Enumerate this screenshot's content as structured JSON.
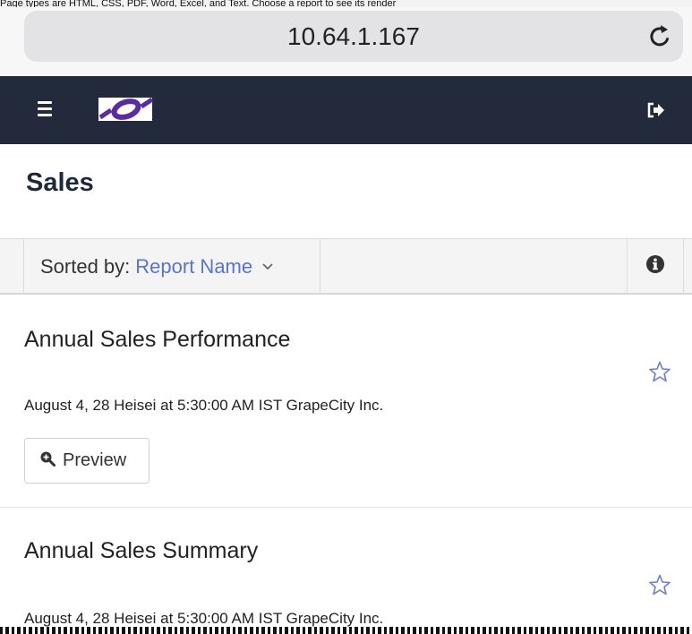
{
  "top_fragment": "Page types are HTML, CSS, PDF, Word, Excel, and Text. Choose a report to see its render",
  "browser": {
    "url": "10.64.1.167",
    "reload_icon": "reload-icon"
  },
  "navbar": {
    "menu_icon": "hamburger-menu-icon",
    "logo": "brand-logo",
    "logout_icon": "logout-icon",
    "background": "#232a3b"
  },
  "page": {
    "title": "Sales"
  },
  "toolbar": {
    "sort_label": "Sorted by:",
    "sort_value": "Report Name",
    "sort_accent": "#5b73c9",
    "info_icon": "info-icon"
  },
  "reports": [
    {
      "name": "Annual Sales Performance",
      "meta": "August 4, 28 Heisei at 5:30:00 AM IST GrapeCity Inc.",
      "favorite_icon": "star-outline-icon",
      "preview_label": "Preview"
    },
    {
      "name": "Annual Sales Summary",
      "meta": "August 4, 28 Heisei at 5:30:00 AM IST GrapeCity Inc.",
      "favorite_icon": "star-outline-icon"
    }
  ]
}
